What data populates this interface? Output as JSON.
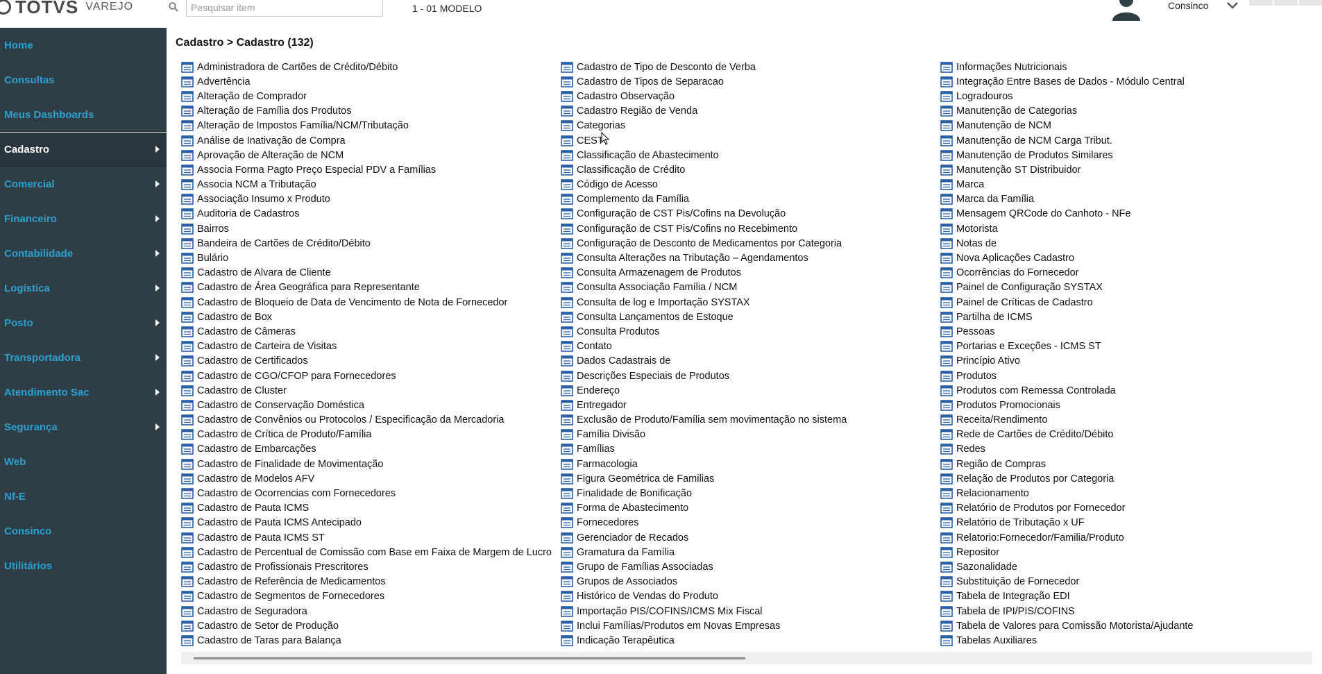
{
  "header": {
    "logo_text": "TOTVS",
    "logo_sub": "VAREJO",
    "search_placeholder": "Pesquisar item",
    "company": "1 - 01 MODELO",
    "user": "Consinco"
  },
  "sidebar": {
    "items": [
      {
        "label": "Home",
        "has_submenu": false,
        "active": false
      },
      {
        "label": "Consultas",
        "has_submenu": false,
        "active": false
      },
      {
        "label": "Meus Dashboards",
        "has_submenu": false,
        "active": false
      },
      {
        "label": "Cadastro",
        "has_submenu": true,
        "active": true
      },
      {
        "label": "Comercial",
        "has_submenu": true,
        "active": false
      },
      {
        "label": "Financeiro",
        "has_submenu": true,
        "active": false
      },
      {
        "label": "Contabilidade",
        "has_submenu": true,
        "active": false
      },
      {
        "label": "Logística",
        "has_submenu": true,
        "active": false
      },
      {
        "label": "Posto",
        "has_submenu": true,
        "active": false
      },
      {
        "label": "Transportadora",
        "has_submenu": true,
        "active": false
      },
      {
        "label": "Atendimento Sac",
        "has_submenu": true,
        "active": false
      },
      {
        "label": "Segurança",
        "has_submenu": true,
        "active": false
      },
      {
        "label": "Web",
        "has_submenu": false,
        "active": false
      },
      {
        "label": "Nf-E",
        "has_submenu": false,
        "active": false
      },
      {
        "label": "Consinco",
        "has_submenu": false,
        "active": false
      },
      {
        "label": "Utilitários",
        "has_submenu": false,
        "active": false
      }
    ]
  },
  "main": {
    "breadcrumb": "Cadastro > Cadastro (132)",
    "columns": [
      [
        "Administradora de Cartões de Crédito/Débito",
        "Advertência",
        "Alteração de Comprador",
        "Alteração de Família dos Produtos",
        "Alteração de Impostos Família/NCM/Tributação",
        "Análise de Inativação de Compra",
        "Aprovação de Alteração de NCM",
        "Associa Forma Pagto Preço Especial PDV a Famílias",
        "Associa NCM a Tributação",
        "Associação Insumo x Produto",
        "Auditoria de Cadastros",
        "Bairros",
        "Bandeira de Cartões de Crédito/Débito",
        "Bulário",
        "Cadastro de Alvara de Cliente",
        "Cadastro de Área Geográfica para Representante",
        "Cadastro de Bloqueio de Data de Vencimento de Nota de Fornecedor",
        "Cadastro de Box",
        "Cadastro de Câmeras",
        "Cadastro de Carteira de Visitas",
        "Cadastro de Certificados",
        "Cadastro de CGO/CFOP para Fornecedores",
        "Cadastro de Cluster",
        "Cadastro de Conservação Doméstica",
        "Cadastro de Convênios ou Protocolos / Especificação da Mercadoria",
        "Cadastro de Crítica de Produto/Família",
        "Cadastro de Embarcações",
        "Cadastro de Finalidade de Movimentação",
        "Cadastro de Modelos AFV",
        "Cadastro de Ocorrencias com Fornecedores",
        "Cadastro de Pauta ICMS",
        "Cadastro de Pauta ICMS Antecipado",
        "Cadastro de Pauta ICMS ST",
        "Cadastro de Percentual de Comissão com Base em Faixa de Margem de Lucro",
        "Cadastro de Profissionais Prescritores",
        "Cadastro de Referência de Medicamentos",
        "Cadastro de Segmentos de Fornecedores",
        "Cadastro de Seguradora",
        "Cadastro de Setor de Produção",
        "Cadastro de Taras para Balança"
      ],
      [
        "Cadastro de Tipo de Desconto de Verba",
        "Cadastro de Tipos de Separacao",
        "Cadastro Observação",
        "Cadastro Região de Venda",
        "Categorias",
        "CEST",
        "Classificação de Abastecimento",
        "Classificação de Crédito",
        "Código de Acesso",
        "Complemento da Família",
        "Configuração de CST Pis/Cofins na Devolução",
        "Configuração de CST Pis/Cofins no Recebimento",
        "Configuração de Desconto de Medicamentos por Categoria",
        "Consulta Alterações na Tributação – Agendamentos",
        "Consulta Armazenagem de Produtos",
        "Consulta Associação Família / NCM",
        "Consulta de log e Importação SYSTAX",
        "Consulta Lançamentos de Estoque",
        "Consulta Produtos",
        "Contato",
        "Dados Cadastrais de",
        "Descrições Especiais de Produtos",
        "Endereço",
        "Entregador",
        "Exclusão de Produto/Família sem movimentação no sistema",
        "Família Divisão",
        "Famílias",
        "Farmacologia",
        "Figura Geométrica de Familias",
        "Finalidade de Bonificação",
        "Forma de Abastecimento",
        "Fornecedores",
        "Gerenciador de Recados",
        "Gramatura da Família",
        "Grupo de Famílias Associadas",
        "Grupos de Associados",
        "Histórico de Vendas do Produto",
        "Importação PIS/COFINS/ICMS Mix Fiscal",
        "Inclui Famílias/Produtos em Novas Empresas",
        "Indicação Terapêutica"
      ],
      [
        "Informações Nutricionais",
        "Integração Entre Bases de Dados - Módulo Central",
        "Logradouros",
        "Manutenção de Categorias",
        "Manutenção de NCM",
        "Manutenção de NCM Carga Tribut.",
        "Manutenção de Produtos Similares",
        "Manutenção ST Distribuidor",
        "Marca",
        "Marca da Família",
        "Mensagem QRCode do Canhoto - NFe",
        "Motorista",
        "Notas de",
        "Nova Aplicações Cadastro",
        "Ocorrências do Fornecedor",
        "Painel de Configuração SYSTAX",
        "Painel de Críticas de Cadastro",
        "Partilha de ICMS",
        "Pessoas",
        "Portarias e Exceções - ICMS ST",
        "Princípio Ativo",
        "Produtos",
        "Produtos com Remessa Controlada",
        "Produtos Promocionais",
        "Receita/Rendimento",
        "Rede de Cartões de Crédito/Débito",
        "Redes",
        "Região de Compras",
        "Relação de Produtos por Categoria",
        "Relacionamento",
        "Relatório de Produtos por Fornecedor",
        "Relatório de Tributação x UF",
        "Relatorio:Fornecedor/Familia/Produto",
        "Repositor",
        "Sazonalidade",
        "Substituição de Fornecedor",
        "Tabela de Integração EDI",
        "Tabela de IPI/PIS/COFINS",
        "Tabela de Valores para Comissão Motorista/Ajudante",
        "Tabelas Auxiliares"
      ]
    ]
  },
  "colors": {
    "sidebar_bg": "#2f3d44",
    "sidebar_link": "#2ea0d0",
    "item_icon": "#2b5fa8"
  }
}
